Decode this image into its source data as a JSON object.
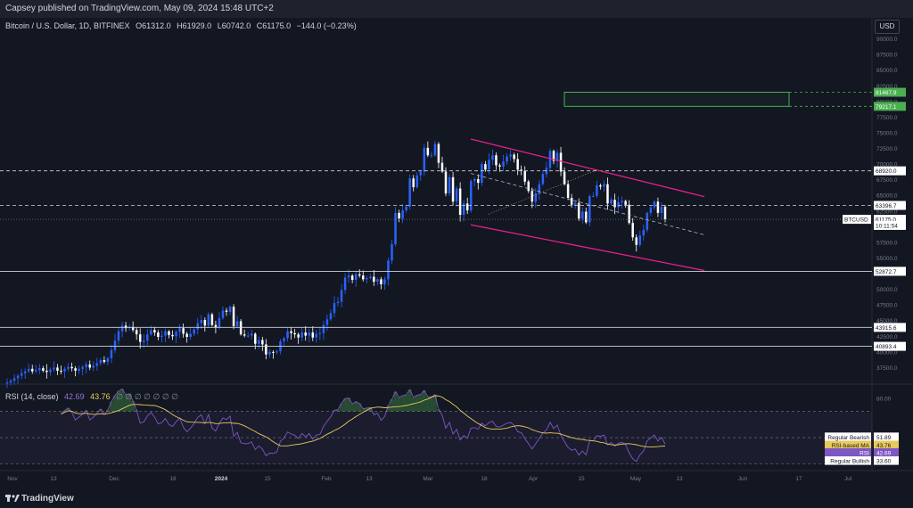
{
  "header": {
    "publisher_line": "Capsey published on TradingView.com, May 09, 2024 15:48 UTC+2"
  },
  "symbol": {
    "title": "Bitcoin / U.S. Dollar, 1D, BITFINEX",
    "open": "O61312.0",
    "high": "H61929.0",
    "low": "L60742.0",
    "close": "C61175.0",
    "change": "−144.0 (−0.23%)"
  },
  "currency_button": "USD",
  "rsi_legend": {
    "label": "RSI (14, close)",
    "rsi": "42.69",
    "ma": "43.76",
    "empty": "∅ ∅ ∅ ∅ ∅ ∅ ∅"
  },
  "footer": {
    "brand": "TradingView"
  },
  "colors": {
    "up": "#2962ff",
    "down": "#ffffff",
    "channel": "#e91e8c",
    "rsi": "#7e57c2",
    "rsi_ma": "#e8c95c",
    "zone": "#4caf50"
  },
  "chart_data": [
    {
      "type": "candlestick",
      "title": "Bitcoin / U.S. Dollar, 1D, BITFINEX",
      "ylim": [
        35000,
        92500
      ],
      "y_ticks": [
        "37500.0",
        "40000.0",
        "42500.0",
        "45000.0",
        "47500.0",
        "50000.0",
        "52500.0",
        "55000.0",
        "57500.0",
        "60000.0",
        "62500.0",
        "65000.0",
        "67500.0",
        "70000.0",
        "72500.0",
        "75000.0",
        "77500.0",
        "80000.0",
        "82500.0",
        "85000.0",
        "87500.0",
        "90000.0"
      ],
      "x_ticks": [
        "Nov",
        "13",
        "Dec",
        "18",
        "2024",
        "15",
        "Feb",
        "13",
        "Mar",
        "18",
        "Apr",
        "15",
        "May",
        "13",
        "Jun",
        "17",
        "Jul"
      ],
      "price_labels": [
        {
          "text": "81467.9",
          "value": 81467.9,
          "color": "#4caf50"
        },
        {
          "text": "79217.1",
          "value": 79217.1,
          "color": "#4caf50"
        },
        {
          "text": "68920.0",
          "value": 68920.0,
          "color": "#ffffff"
        },
        {
          "text": "63396.7",
          "value": 63396.7,
          "color": "#ffffff"
        },
        {
          "text": "61175.0",
          "value": 61175.0,
          "color": "#ffffff"
        },
        {
          "text": "10:11:54",
          "value": 60200,
          "color": "#ffffff"
        },
        {
          "text": "52872.7",
          "value": 52872.7,
          "color": "#ffffff"
        },
        {
          "text": "43915.6",
          "value": 43915.6,
          "color": "#ffffff"
        },
        {
          "text": "40893.4",
          "value": 40893.4,
          "color": "#ffffff"
        }
      ],
      "symbol_tag": "BTCUSD",
      "horizontal_levels": [
        68920.0,
        63396.7,
        52872.7,
        43915.6,
        40893.4
      ],
      "closes": [
        35100,
        35400,
        35800,
        36200,
        36600,
        36900,
        37300,
        36900,
        37100,
        37400,
        37000,
        36800,
        37200,
        37500,
        37000,
        36900,
        37300,
        37600,
        37400,
        37000,
        37300,
        37600,
        38000,
        37500,
        37800,
        38200,
        38700,
        38400,
        39000,
        40300,
        41800,
        43300,
        44200,
        43800,
        44000,
        43500,
        42800,
        41600,
        41800,
        42800,
        43500,
        43100,
        42400,
        42600,
        43300,
        42700,
        42500,
        43200,
        43800,
        42900,
        42400,
        42900,
        43600,
        44600,
        45100,
        44200,
        46000,
        44300,
        43900,
        45400,
        46600,
        46400,
        47200,
        44100,
        44900,
        42800,
        42600,
        42600,
        42900,
        41300,
        41900,
        41200,
        39600,
        40000,
        39900,
        40100,
        41700,
        42200,
        43300,
        43000,
        42800,
        42300,
        43100,
        42600,
        43100,
        42300,
        42900,
        43000,
        44300,
        45200,
        46200,
        47800,
        48000,
        49900,
        51900,
        52200,
        51500,
        52400,
        52200,
        51600,
        51800,
        52000,
        51200,
        51600,
        50800,
        51600,
        54600,
        57200,
        62200,
        61300,
        62600,
        63200,
        67700,
        66300,
        68200,
        68800,
        72600,
        71400,
        71400,
        73200,
        70200,
        68800,
        65300,
        67900,
        64000,
        66100,
        61900,
        63700,
        62600,
        67300,
        67600,
        67000,
        70000,
        69100,
        70700,
        71400,
        69800,
        69600,
        70400,
        71200,
        71500,
        70800,
        69100,
        68900,
        67200,
        65700,
        64000,
        65300,
        66800,
        68400,
        69400,
        72100,
        70500,
        71800,
        68800,
        66800,
        64600,
        63500,
        63800,
        61300,
        62400,
        60700,
        64900,
        64900,
        66600,
        66400,
        66800,
        63700,
        64300,
        63100,
        63900,
        64100,
        63500,
        60600,
        58300,
        57100,
        58600,
        59500,
        62200,
        63100,
        64000,
        62200,
        63200,
        61200
      ],
      "series_ranges": {
        "start_label": "Nov",
        "end_label": "May"
      }
    },
    {
      "type": "line",
      "title": "RSI (14, close)",
      "ylim": [
        25,
        90
      ],
      "y_ticks": [
        "80.00"
      ],
      "series": [
        {
          "name": "RSI",
          "last": 42.69,
          "color": "#7e57c2"
        },
        {
          "name": "RSI-based MA",
          "last": 43.76,
          "color": "#e8c95c"
        }
      ],
      "level_labels": [
        {
          "text": "Regular Bearish",
          "value_text": "51.89",
          "value": 51.89
        },
        {
          "text": "RSI-based MA",
          "value_text": "43.76",
          "value": 43.76
        },
        {
          "text": "RSI",
          "value_text": "42.69",
          "value": 42.69
        },
        {
          "text": "Regular Bullish",
          "value_text": "33.60",
          "value": 33.6
        }
      ],
      "bands": {
        "upper": 70,
        "middle": 50,
        "lower": 30
      }
    }
  ]
}
